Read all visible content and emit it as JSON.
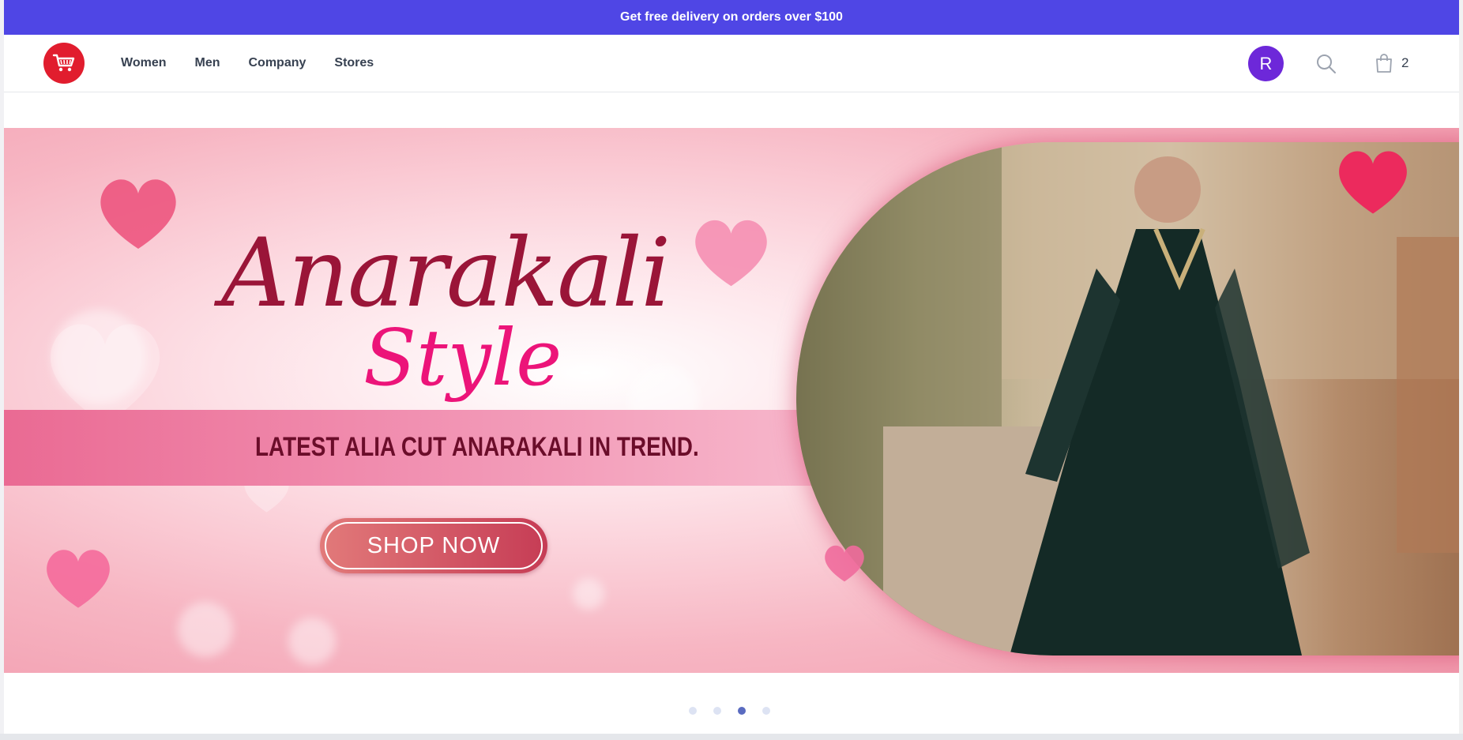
{
  "announcement": {
    "text": "Get free delivery on orders over $100"
  },
  "nav": {
    "logo_icon": "shopping-cart-icon",
    "links": [
      "Women",
      "Men",
      "Company",
      "Stores"
    ],
    "avatar_initial": "R",
    "search_icon": "search-icon",
    "cart_icon": "shopping-bag-icon",
    "cart_count": "2"
  },
  "hero": {
    "title": "Anarakali",
    "subtitle": "Style",
    "tagline": "LATEST ALIA CUT ANARAKALI IN TREND.",
    "cta_label": "SHOP NOW",
    "colors": {
      "title": "#9a1538",
      "subtitle": "#ec1479",
      "tagline": "#6b0d2a",
      "band": "#ea6a93"
    }
  },
  "carousel": {
    "slide_count": 4,
    "active_index": 2
  },
  "colors": {
    "accent": "#4f46e5",
    "logo_bg": "#e11d2e",
    "avatar_bg": "#6d28d9"
  }
}
